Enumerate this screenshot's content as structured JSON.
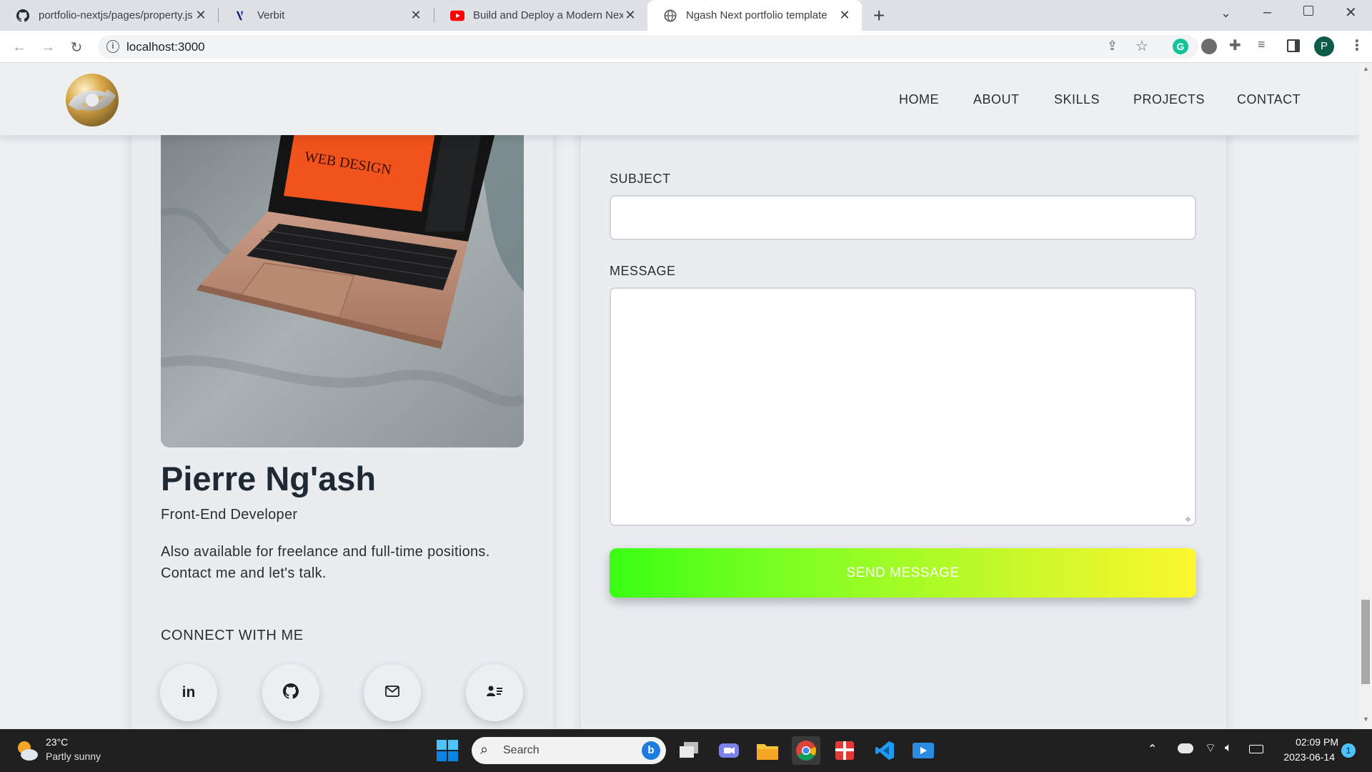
{
  "browser": {
    "tabs": [
      {
        "title": "portfolio-nextjs/pages/property.js",
        "icon": "github-icon"
      },
      {
        "title": "Verbit",
        "icon": "verbit-icon"
      },
      {
        "title": "Build and Deploy a Modern Next.js",
        "icon": "youtube-icon"
      },
      {
        "title": "Ngash Next portfolio template",
        "icon": "globe-icon",
        "active": true
      }
    ],
    "url": "localhost:3000",
    "profile_initial": "P"
  },
  "header": {
    "nav": [
      "HOME",
      "ABOUT",
      "SKILLS",
      "PROJECTS",
      "CONTACT"
    ]
  },
  "profile": {
    "image_text": "WEB DESIGN",
    "name": "Pierre Ng'ash",
    "role": "Front-End Developer",
    "description": "Also available for freelance and full-time positions. Contact me and let's talk.",
    "connect_heading": "CONNECT WITH ME",
    "socials": [
      "linkedin-icon",
      "github-icon",
      "mail-icon",
      "contact-card-icon"
    ]
  },
  "form": {
    "subject_label": "SUBJECT",
    "message_label": "MESSAGE",
    "subject_value": "",
    "message_value": "",
    "submit_label": "SEND MESSAGE"
  },
  "taskbar": {
    "weather_temp": "23°C",
    "weather_desc": "Partly sunny",
    "search_placeholder": "Search",
    "time": "02:09 PM",
    "date": "2023-06-14",
    "notification_count": "1"
  },
  "colors": {
    "page_bg": "#ecf0f3",
    "button_gradient_start": "#39ff14",
    "button_gradient_end": "#fcf72e",
    "taskbar_bg": "#202020"
  }
}
